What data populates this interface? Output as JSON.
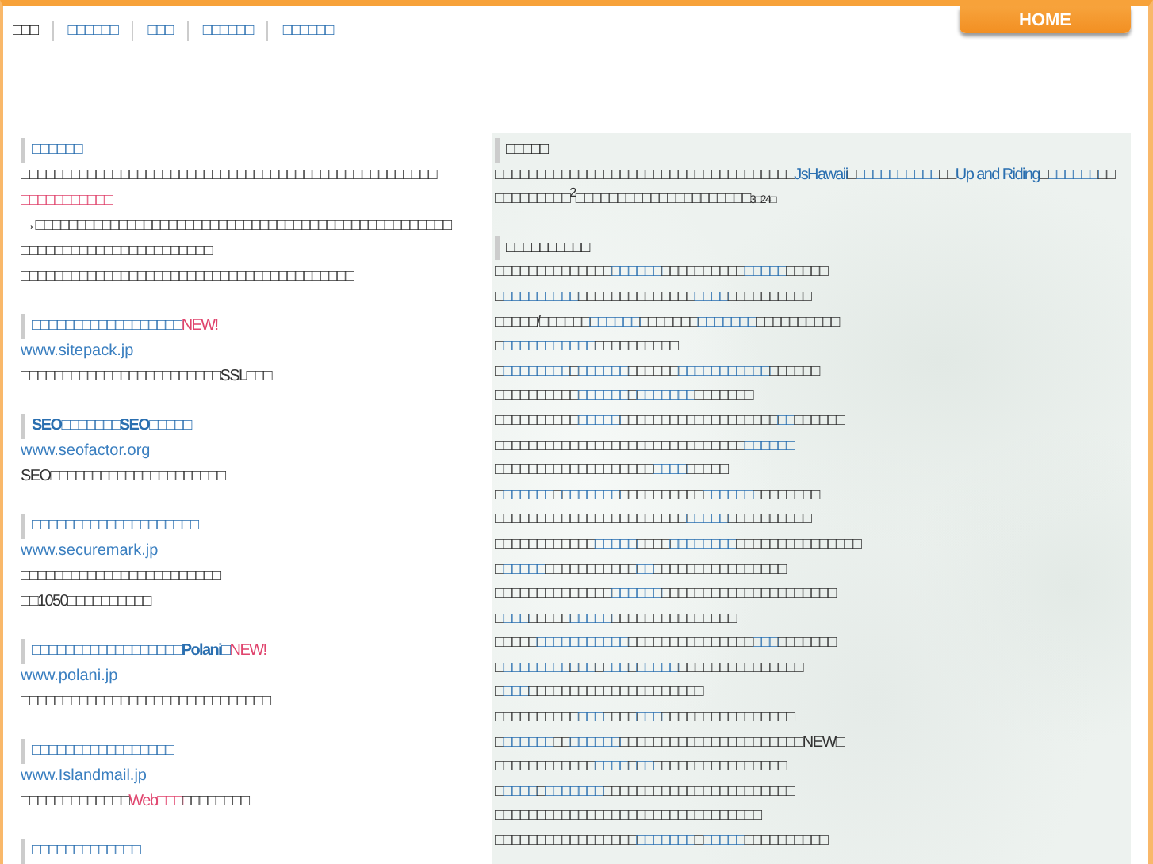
{
  "nav": {
    "items": [
      {
        "label": "□□□",
        "selected": true
      },
      {
        "label": "□□□□□□",
        "selected": false
      },
      {
        "label": "□□□",
        "selected": false
      },
      {
        "label": "□□□□□□",
        "selected": false
      },
      {
        "label": "□□□□□□",
        "selected": false
      }
    ],
    "home_tab": {
      "label": "HOME"
    }
  },
  "left_sections": [
    {
      "title": "□□□□□□",
      "lines": [
        [
          {
            "kind": "plain",
            "text": "□□□□□□□□□□□□□□□□□□□□□□□□□□□□□□□□□□□□□□□□□□□□□□□□□□"
          }
        ],
        [
          {
            "kind": "highlight",
            "text": "□□□□□□□□□□□"
          }
        ],
        [
          {
            "kind": "plain",
            "text": "→□□□□□□□□□□□□□□□□□□□□□□□□□□□□□□□□□□□□□□□□□□□□□□□□□□"
          }
        ],
        [
          {
            "kind": "plain",
            "text": "□□□□□□□□□□□□□□□□□□□□□□□"
          }
        ],
        [
          {
            "kind": "plain",
            "text": "□□□□□□□□□□□□□□□□□□□□□□□□□□□□□□□□□□□□□□□□"
          }
        ]
      ]
    },
    {
      "title": "□□□□□□□□□□□□□□□□□□",
      "new": "NEW!",
      "url": "www.sitepack.jp",
      "lines": [
        [
          {
            "kind": "plain",
            "text": "□□□□□□□□□□□□□□□□□□□□□□□□SSL□□□"
          }
        ]
      ]
    },
    {
      "title": "SEO□□□□□□□SEO□□□□□",
      "url": "www.seofactor.org",
      "lines": [
        [
          {
            "kind": "plain",
            "text": "SEO□□□□□□□□□□□□□□□□□□□□□"
          }
        ]
      ]
    },
    {
      "title": "□□□□□□□□□□□□□□□□□□□□",
      "url": "www.securemark.jp",
      "lines": [
        [
          {
            "kind": "plain",
            "text": "□□□□□□□□□□□□□□□□□□□□□□□□"
          }
        ],
        [
          {
            "kind": "plain",
            "text": "□□1050□□□□□□□□□□"
          }
        ]
      ]
    },
    {
      "title": "□□□□□□□□□□□□□□□□□□Polani□",
      "new": "NEW!",
      "url": "www.polani.jp",
      "lines": [
        [
          {
            "kind": "plain",
            "text": "□□□□□□□□□□□□□□□□□□□□□□□□□□□□□□"
          }
        ]
      ]
    },
    {
      "title": "□□□□□□□□□□□□□□□□□",
      "url": "www.Islandmail.jp",
      "lines": [
        [
          {
            "kind": "plain",
            "text": "□□□□□□□□□□□□□"
          },
          {
            "kind": "highlight",
            "text": "Web□□□"
          },
          {
            "kind": "plain",
            "text": "□□□□□□□□"
          }
        ]
      ]
    },
    {
      "title": "□□□□□□□□□□□□□"
    }
  ],
  "right_sections": [
    {
      "title": "□□□□□",
      "lines": [
        [
          {
            "kind": "plain",
            "text": "□□□□□□□□□□□□□□□□□□□□□□□□□□□□□□□□□□□□"
          },
          {
            "kind": "link",
            "text": "JsHawaii"
          },
          {
            "kind": "plain",
            "text": "□"
          },
          {
            "kind": "link",
            "text": "□□□□□□□□□□"
          },
          {
            "kind": "plain",
            "text": "□□"
          },
          {
            "kind": "link",
            "text": "Up and Riding"
          },
          {
            "kind": "plain",
            "text": "□"
          },
          {
            "kind": "link",
            "text": "□□□□□□"
          },
          {
            "kind": "plain",
            "text": "□□"
          }
        ],
        [
          {
            "kind": "plain",
            "text": "□□□□□□□□□$^{2}$□□□□□□□□□□□□□□□□□□□□□"
          },
          {
            "kind": "small",
            "text": "3□24□"
          }
        ]
      ]
    },
    {
      "title": "□□□□□□□□□□",
      "lines": [
        [
          {
            "kind": "plain",
            "text": "□□□□□□□□□□□□□□"
          },
          {
            "kind": "link",
            "text": "□□□□□□"
          },
          {
            "kind": "plain",
            "text": "□□□□□□□□□□"
          },
          {
            "kind": "link",
            "text": "□□□□□"
          },
          {
            "kind": "plain",
            "text": "□□□□□"
          }
        ],
        [
          {
            "kind": "plain",
            "text": "□"
          },
          {
            "kind": "link",
            "text": "□□□□□□□□□"
          },
          {
            "kind": "plain",
            "text": "□□□□□□□□□□□□□□"
          },
          {
            "kind": "link",
            "text": "□□□□"
          },
          {
            "kind": "plain",
            "text": "□□□□□□□□□□"
          }
        ],
        [
          {
            "kind": "plain",
            "text": "□□□□□/□□□□□□"
          },
          {
            "kind": "link",
            "text": "□□□□□□"
          },
          {
            "kind": "plain",
            "text": "□□□□□□□"
          },
          {
            "kind": "link",
            "text": "□□□□□□□"
          },
          {
            "kind": "plain",
            "text": "□□□□□□□□□□"
          }
        ],
        [
          {
            "kind": "plain",
            "text": "□"
          },
          {
            "kind": "link",
            "text": "□□□□□□□□□□□"
          },
          {
            "kind": "plain",
            "text": "□□□□□□□□□□"
          }
        ],
        [
          {
            "kind": "plain",
            "text": "□"
          },
          {
            "kind": "link",
            "text": "□□□□□□□□"
          },
          {
            "kind": "plain",
            "text": "□"
          },
          {
            "kind": "link",
            "text": "□□□□□□"
          },
          {
            "kind": "plain",
            "text": "□□□□□□"
          },
          {
            "kind": "link",
            "text": "□□□□□□□□□□□"
          },
          {
            "kind": "plain",
            "text": "□□□□□□"
          }
        ],
        [
          {
            "kind": "plain",
            "text": "□□□□□□□□□□"
          },
          {
            "kind": "link",
            "text": "□□□□□□"
          },
          {
            "kind": "plain",
            "text": "□"
          },
          {
            "kind": "link",
            "text": "□□□□□□□"
          },
          {
            "kind": "plain",
            "text": "□□□□□□□"
          }
        ],
        [
          {
            "kind": "plain",
            "text": "□□□□□□□□□□"
          },
          {
            "kind": "link",
            "text": "□□□□□"
          },
          {
            "kind": "plain",
            "text": "□□□□□□□□□□□□□□□□□□□"
          },
          {
            "kind": "link",
            "text": "□□"
          },
          {
            "kind": "plain",
            "text": "□□□□□□"
          }
        ],
        [
          {
            "kind": "plain",
            "text": "□□□□□□□□□□□□□□□□□□□□□□□□□□□□□□"
          },
          {
            "kind": "link",
            "text": "□□□□□□"
          }
        ],
        [
          {
            "kind": "plain",
            "text": "□□□□□□□□□□□□□□□□□□□"
          },
          {
            "kind": "link",
            "text": "□□□□"
          },
          {
            "kind": "plain",
            "text": "□□□□□"
          }
        ],
        [
          {
            "kind": "plain",
            "text": "□"
          },
          {
            "kind": "link",
            "text": "□□□□□□"
          },
          {
            "kind": "plain",
            "text": "□"
          },
          {
            "kind": "link",
            "text": "□□□□□□□"
          },
          {
            "kind": "plain",
            "text": "□□□□□□□□□□"
          },
          {
            "kind": "link",
            "text": "□□□□□□"
          },
          {
            "kind": "plain",
            "text": "□□□□□□□□"
          }
        ],
        [
          {
            "kind": "plain",
            "text": "□□□□□□□□□□□□□□□□□□□□□□□"
          },
          {
            "kind": "link",
            "text": "□□□□□"
          },
          {
            "kind": "plain",
            "text": "□□□□□□□□□□"
          }
        ],
        [
          {
            "kind": "plain",
            "text": "□□□□□□□□□□□□"
          },
          {
            "kind": "link",
            "text": "□□□□□"
          },
          {
            "kind": "plain",
            "text": "□□□□"
          },
          {
            "kind": "link",
            "text": "□□□□□□□□"
          },
          {
            "kind": "plain",
            "text": "□□□□□□□□□□□□□□□"
          }
        ],
        [
          {
            "kind": "plain",
            "text": "□"
          },
          {
            "kind": "link",
            "text": "□□□□□"
          },
          {
            "kind": "plain",
            "text": "□□□□□□□□□□□"
          },
          {
            "kind": "link",
            "text": "□□"
          },
          {
            "kind": "plain",
            "text": "□□□□□□□□□□□□□□□□"
          }
        ],
        [
          {
            "kind": "plain",
            "text": "□□□□□□□□□□□□□□"
          },
          {
            "kind": "link",
            "text": "□□□□□□"
          },
          {
            "kind": "plain",
            "text": "□□□□□□□□□□□□□□□□□□□□□"
          }
        ],
        [
          {
            "kind": "plain",
            "text": "□"
          },
          {
            "kind": "link",
            "text": "□□□"
          },
          {
            "kind": "plain",
            "text": "□□□□□"
          },
          {
            "kind": "link",
            "text": "□□□□□"
          },
          {
            "kind": "plain",
            "text": "□□□□□□□□□□□□□□□"
          }
        ],
        [
          {
            "kind": "plain",
            "text": "□□□□□"
          },
          {
            "kind": "link",
            "text": "□□□□□□□□□□□"
          },
          {
            "kind": "plain",
            "text": "□□□□□□□□□□□□□□□"
          },
          {
            "kind": "link",
            "text": "□□□"
          },
          {
            "kind": "plain",
            "text": "□□□□□□□"
          }
        ],
        [
          {
            "kind": "plain",
            "text": "□"
          },
          {
            "kind": "link",
            "text": "□□□□□□□□"
          },
          {
            "kind": "plain",
            "text": "□"
          },
          {
            "kind": "link",
            "text": "□□"
          },
          {
            "kind": "plain",
            "text": "□"
          },
          {
            "kind": "link",
            "text": "□□□"
          },
          {
            "kind": "plain",
            "text": "□"
          },
          {
            "kind": "link",
            "text": "□□□□□"
          },
          {
            "kind": "plain",
            "text": "□□□□□□□□□□□□□□□"
          }
        ],
        [
          {
            "kind": "plain",
            "text": "□"
          },
          {
            "kind": "link",
            "text": "□□□"
          },
          {
            "kind": "plain",
            "text": "□□□□□□□□□□□□□□□□□□□□□"
          }
        ],
        [
          {
            "kind": "plain",
            "text": "□□□□□□□□□□"
          },
          {
            "kind": "link",
            "text": "□□□"
          },
          {
            "kind": "plain",
            "text": "□□□□"
          },
          {
            "kind": "link",
            "text": "□□□"
          },
          {
            "kind": "plain",
            "text": "□□□□□□□□□□□□□□□□"
          }
        ],
        [
          {
            "kind": "plain",
            "text": "□"
          },
          {
            "kind": "link",
            "text": "□□□□□□"
          },
          {
            "kind": "plain",
            "text": "□□"
          },
          {
            "kind": "link",
            "text": "□□□□□□"
          },
          {
            "kind": "plain",
            "text": "□□□□□□□□□□□□□□□□□□□□□□NEW□"
          }
        ],
        [
          {
            "kind": "plain",
            "text": "□□□□□□□□□□□□"
          },
          {
            "kind": "link",
            "text": "□□□□"
          },
          {
            "kind": "plain",
            "text": "□"
          },
          {
            "kind": "link",
            "text": "□□"
          },
          {
            "kind": "plain",
            "text": "□□□□□□□□□□□□□□□□"
          }
        ],
        [
          {
            "kind": "plain",
            "text": "□"
          },
          {
            "kind": "link",
            "text": "□□□□"
          },
          {
            "kind": "plain",
            "text": "□"
          },
          {
            "kind": "link",
            "text": "□□□□□□□"
          },
          {
            "kind": "plain",
            "text": "□□□□□□□□□□□□□□□□□□□□□□□"
          }
        ],
        [
          {
            "kind": "plain",
            "text": "□□□□□□□□□□□□□□□□□□□□□□□□□□□□□□□□"
          }
        ],
        [
          {
            "kind": "plain",
            "text": "□□□□□□□□□□□□□□□□□"
          },
          {
            "kind": "link",
            "text": "□□□□□□□"
          },
          {
            "kind": "plain",
            "text": "□"
          },
          {
            "kind": "link",
            "text": "□□□□□"
          },
          {
            "kind": "plain",
            "text": "□□□□□□□□□□"
          }
        ]
      ]
    }
  ]
}
